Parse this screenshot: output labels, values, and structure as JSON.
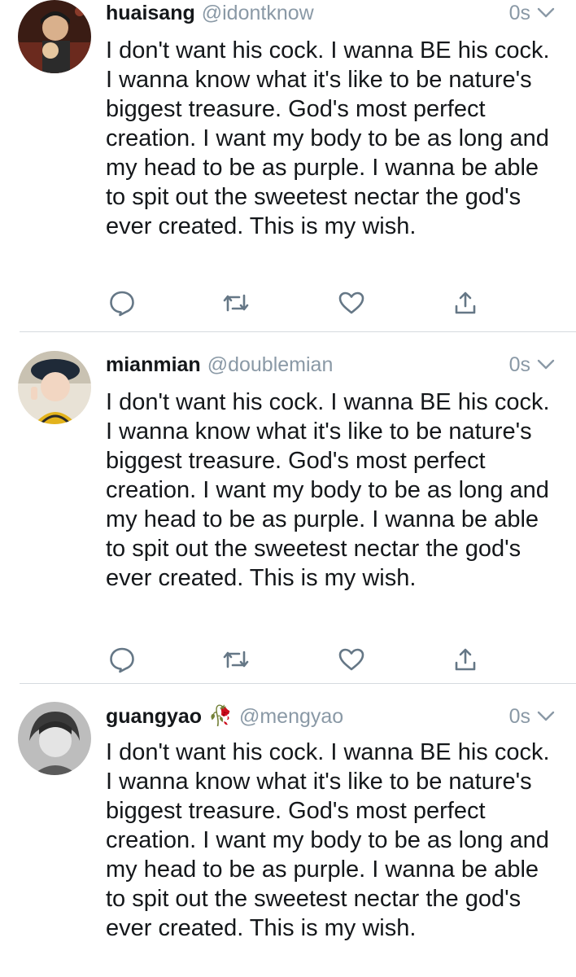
{
  "colors": {
    "text": "#14171a",
    "secondary": "#8a99a6",
    "divider": "#d6dbdf",
    "icon": "#657786"
  },
  "tweets": [
    {
      "display_name": "huaisang",
      "badge_icon": "rose-icon",
      "handle": "@idontknow",
      "timestamp": "0s",
      "text": "I don't want his cock. I wanna BE his cock. I wanna know what it's like to be nature's biggest treasure. God's most perfect creation. I want my body to be as long and my head to be as purple. I wanna be able to spit out the sweetest nectar the god's ever created. This is my wish.",
      "actions": [
        "reply-icon",
        "retweet-icon",
        "like-icon",
        "share-icon"
      ]
    },
    {
      "display_name": "mianmian",
      "handle": "@doublemian",
      "timestamp": "0s",
      "text": "I don't want his cock. I wanna BE his cock. I wanna know what it's like to be nature's biggest treasure. God's most perfect creation. I want my body to be as long and my head to be as purple. I wanna be able to spit out the sweetest nectar the god's ever created. This is my wish.",
      "actions": [
        "reply-icon",
        "retweet-icon",
        "like-icon",
        "share-icon"
      ]
    },
    {
      "display_name": "guangyao",
      "badge": "🥀",
      "handle": "@mengyao",
      "timestamp": "0s",
      "text": "I don't want his cock. I wanna BE his cock. I wanna know what it's like to be nature's biggest treasure. God's most perfect creation. I want my body to be as long and my head to be as purple. I wanna be able to spit out the sweetest nectar the god's ever created. This is my wish."
    }
  ]
}
